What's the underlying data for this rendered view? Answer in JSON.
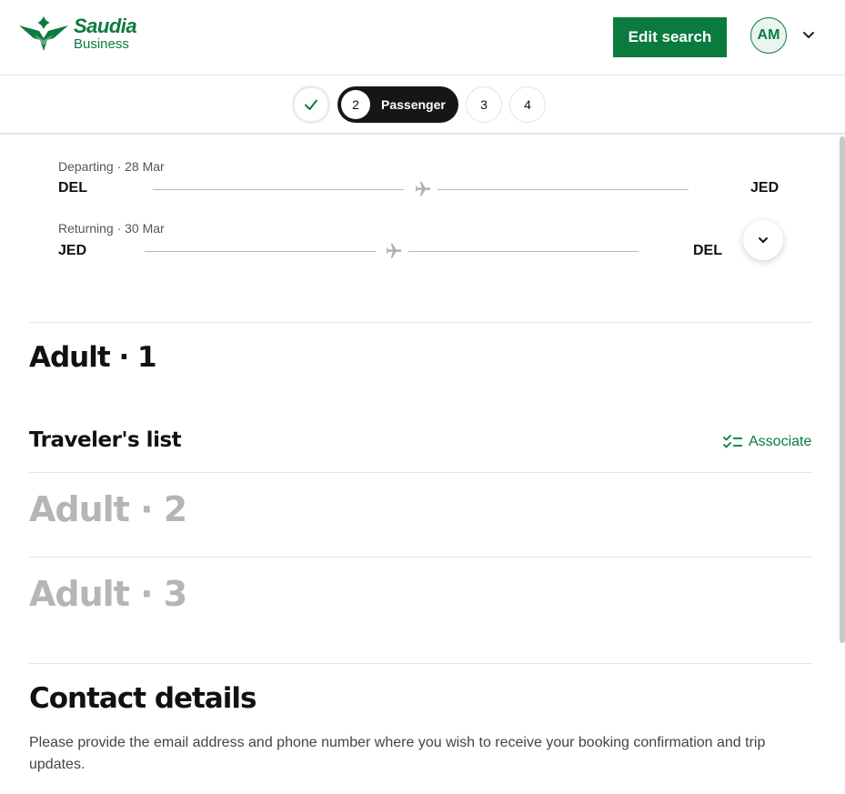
{
  "header": {
    "brand_name": "Saudia",
    "brand_sub": "Business",
    "edit_search_label": "Edit search",
    "user_initials": "AM"
  },
  "stepper": {
    "steps": [
      {
        "number": "",
        "label": "",
        "status": "done"
      },
      {
        "number": "2",
        "label": "Passenger",
        "status": "active"
      },
      {
        "number": "3",
        "label": "",
        "status": "upcoming"
      },
      {
        "number": "4",
        "label": "",
        "status": "upcoming"
      }
    ]
  },
  "itinerary": {
    "departing": {
      "label": "Departing · 28 Mar",
      "from": "DEL",
      "to": "JED"
    },
    "returning": {
      "label": "Returning · 30 Mar",
      "from": "JED",
      "to": "DEL"
    }
  },
  "passengers": {
    "adult1_title": "Adult · 1",
    "travelers_list_title": "Traveler's list",
    "associate_label": "Associate",
    "adult2_title": "Adult · 2",
    "adult3_title": "Adult · 3"
  },
  "contact": {
    "title": "Contact details",
    "description": "Please provide the email address and phone number where you wish to receive your booking confirmation and trip updates."
  },
  "colors": {
    "brand_green": "#0b7a3f",
    "stepper_active": "#161616",
    "muted_text": "#b5b5b5"
  },
  "icons": {
    "logo": "saudia-logo-icon",
    "avatar_menu": "chevron-down-icon",
    "step_done": "check-icon",
    "flight": "airplane-icon",
    "expand": "chevron-down-icon",
    "associate": "checklist-icon"
  }
}
